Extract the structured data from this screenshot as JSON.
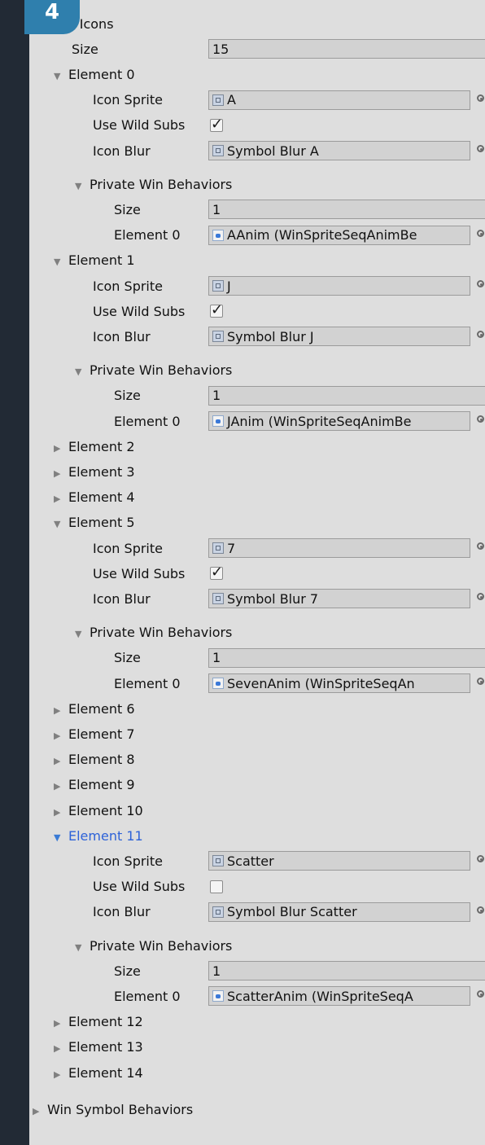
{
  "badge": "4",
  "slot_icons": {
    "label": "Slot Icons",
    "size_label": "Size",
    "size_value": "15",
    "elements": [
      {
        "label": "Element 0",
        "expanded": true,
        "icon_sprite": "A",
        "use_wild": true,
        "icon_blur": "Symbol Blur A",
        "pwb_size": "1",
        "pwb_element": "AAnim (WinSpriteSeqAnimBe"
      },
      {
        "label": "Element 1",
        "expanded": true,
        "icon_sprite": "J",
        "use_wild": true,
        "icon_blur": "Symbol Blur J",
        "pwb_size": "1",
        "pwb_element": "JAnim (WinSpriteSeqAnimBe"
      },
      {
        "label": "Element 2",
        "expanded": false
      },
      {
        "label": "Element 3",
        "expanded": false
      },
      {
        "label": "Element 4",
        "expanded": false
      },
      {
        "label": "Element 5",
        "expanded": true,
        "icon_sprite": "7",
        "use_wild": true,
        "icon_blur": "Symbol Blur 7",
        "pwb_size": "1",
        "pwb_element": "SevenAnim (WinSpriteSeqAn"
      },
      {
        "label": "Element 6",
        "expanded": false
      },
      {
        "label": "Element 7",
        "expanded": false
      },
      {
        "label": "Element 8",
        "expanded": false
      },
      {
        "label": "Element 9",
        "expanded": false
      },
      {
        "label": "Element 10",
        "expanded": false
      },
      {
        "label": "Element 11",
        "expanded": true,
        "selected": true,
        "icon_sprite": "Scatter",
        "use_wild": false,
        "icon_blur": "Symbol Blur Scatter",
        "pwb_size": "1",
        "pwb_element": "ScatterAnim (WinSpriteSeqA"
      },
      {
        "label": "Element 12",
        "expanded": false
      },
      {
        "label": "Element 13",
        "expanded": false
      },
      {
        "label": "Element 14",
        "expanded": false
      }
    ]
  },
  "field_labels": {
    "icon_sprite": "Icon Sprite",
    "use_wild": "Use Wild Subs",
    "icon_blur": "Icon Blur",
    "pwb": "Private Win Behaviors",
    "size": "Size",
    "element0": "Element 0"
  },
  "win_symbol_behaviors": "Win Symbol Behaviors",
  "colors": {
    "accent": "#2f7fad",
    "selected_text": "#2d62d8",
    "panel_bg": "#dedede"
  }
}
